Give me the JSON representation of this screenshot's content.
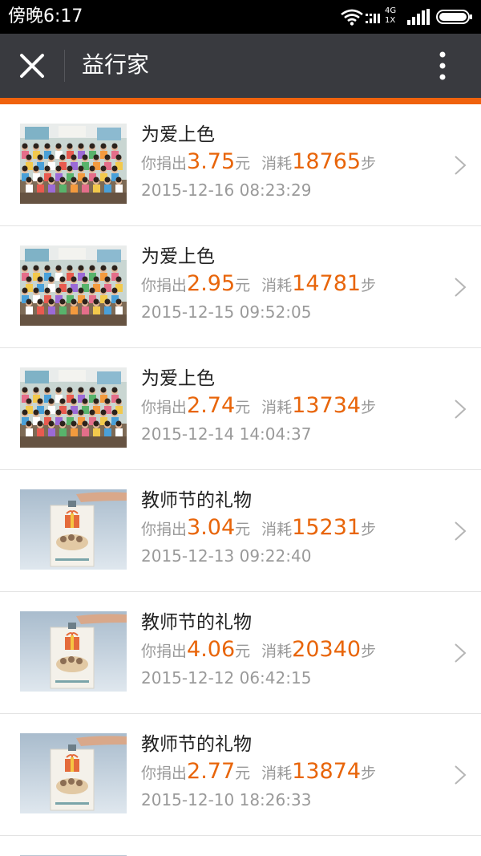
{
  "status_bar": {
    "time": "傍晚6:17",
    "network_top": "4G",
    "network_bottom": "1X",
    "icons": [
      "wifi-icon",
      "cellular-signal-icon",
      "battery-icon"
    ]
  },
  "header": {
    "title": "益行家",
    "close_icon": "close-icon",
    "more_icon": "more-vertical-icon",
    "accent_color": "#f0620d",
    "bar_color": "#393a3f"
  },
  "labels": {
    "donate_prefix": "你捐出",
    "currency_unit": "元",
    "consume_prefix": "消耗",
    "steps_unit": "步"
  },
  "items": [
    {
      "title": "为爱上色",
      "amount": "3.75",
      "steps": "18765",
      "date": "2015-12-16 08:23:29",
      "thumb": "classroom"
    },
    {
      "title": "为爱上色",
      "amount": "2.95",
      "steps": "14781",
      "date": "2015-12-15 09:52:05",
      "thumb": "classroom"
    },
    {
      "title": "为爱上色",
      "amount": "2.74",
      "steps": "13734",
      "date": "2015-12-14 14:04:37",
      "thumb": "classroom"
    },
    {
      "title": "教师节的礼物",
      "amount": "3.04",
      "steps": "15231",
      "date": "2015-12-13 09:22:40",
      "thumb": "gift-card"
    },
    {
      "title": "教师节的礼物",
      "amount": "4.06",
      "steps": "20340",
      "date": "2015-12-12 06:42:15",
      "thumb": "gift-card"
    },
    {
      "title": "教师节的礼物",
      "amount": "2.77",
      "steps": "13874",
      "date": "2015-12-10 18:26:33",
      "thumb": "gift-card"
    }
  ]
}
